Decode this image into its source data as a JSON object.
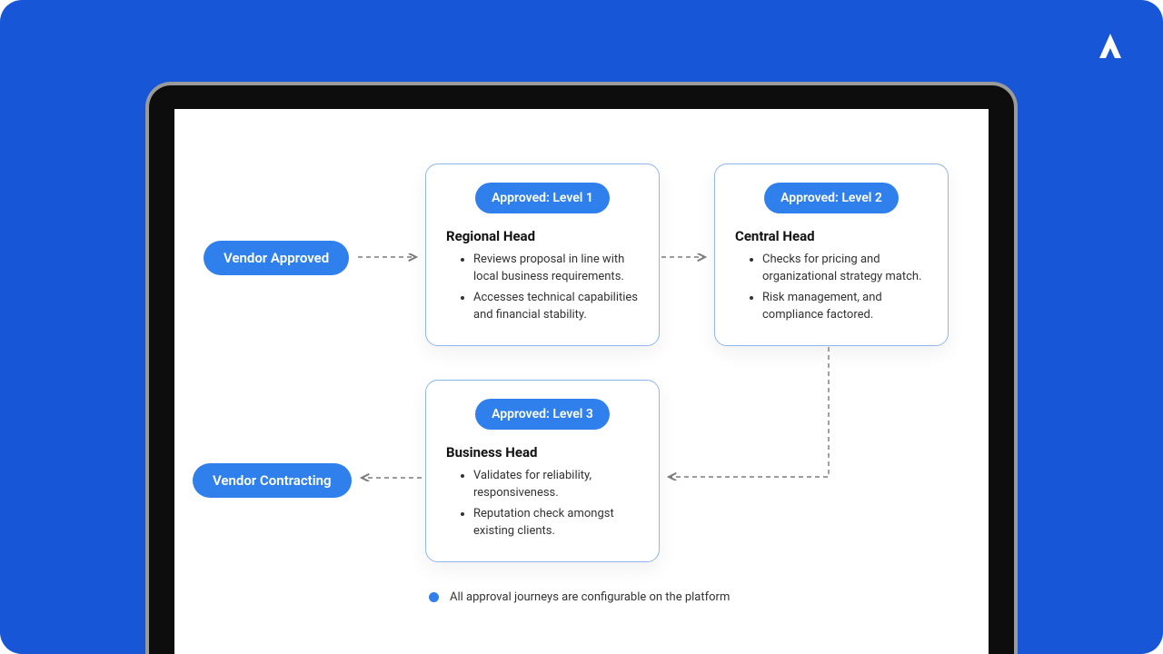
{
  "logo_name": "brand-logo",
  "nodes": {
    "start": {
      "label": "Vendor Approved"
    },
    "level1": {
      "badge": "Approved: Level 1",
      "title": "Regional Head",
      "bullets": [
        "Reviews proposal in line with local business requirements.",
        "Accesses technical capabilities and financial stability."
      ]
    },
    "level2": {
      "badge": "Approved: Level 2",
      "title": "Central Head",
      "bullets": [
        "Checks for pricing and organizational strategy match.",
        " Risk management, and compliance factored."
      ]
    },
    "level3": {
      "badge": "Approved: Level 3",
      "title": "Business Head",
      "bullets": [
        "Validates for reliability, responsiveness.",
        "Reputation check amongst existing clients."
      ]
    },
    "end": {
      "label": "Vendor Contracting"
    }
  },
  "legend": "All approval journeys are configurable on the platform",
  "colors": {
    "accent": "#2f80ed",
    "bg": "#1756d6"
  }
}
